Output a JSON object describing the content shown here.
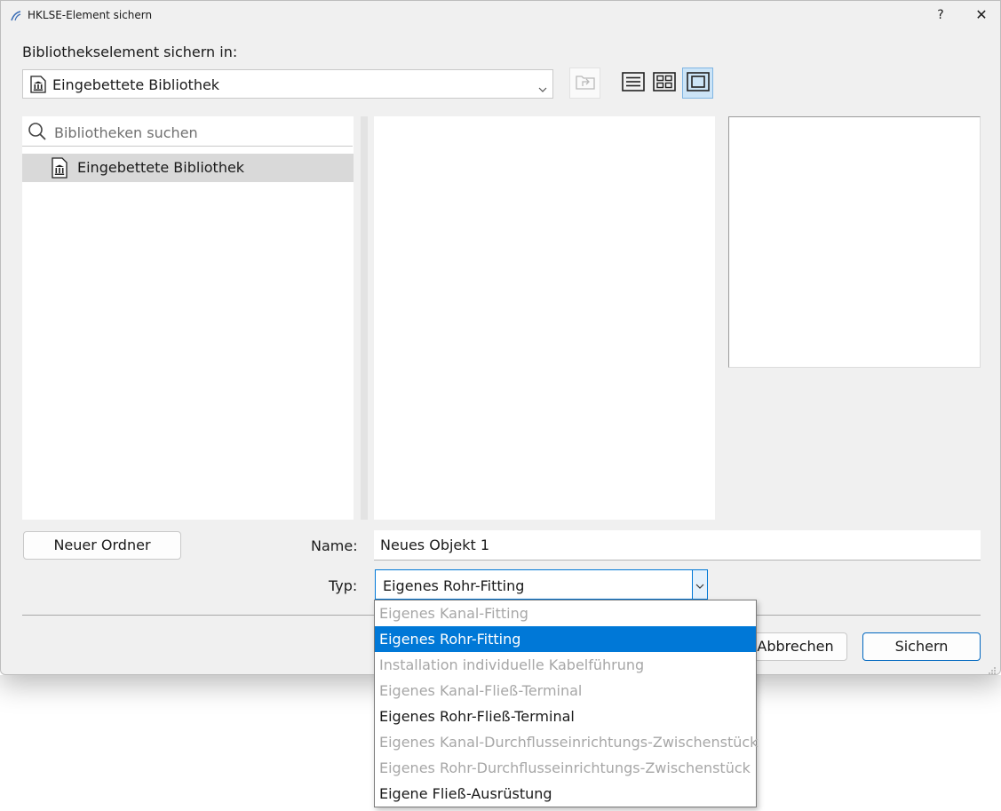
{
  "window": {
    "title": "HKLSE-Element sichern",
    "help_label": "?",
    "close_label": "✕"
  },
  "location": {
    "label": "Bibliothekselement sichern in:",
    "selected": "Eingebettete Bibliothek"
  },
  "search": {
    "placeholder": "Bibliotheken suchen"
  },
  "tree": {
    "items": [
      {
        "label": "Eingebettete Bibliothek",
        "selected": true
      }
    ]
  },
  "form": {
    "new_folder_label": "Neuer Ordner",
    "name_label": "Name:",
    "name_value": "Neues Objekt 1",
    "type_label": "Typ:",
    "type_value": "Eigenes Rohr-Fitting"
  },
  "type_options": [
    {
      "label": "Eigenes Kanal-Fitting",
      "state": "disabled"
    },
    {
      "label": "Eigenes Rohr-Fitting",
      "state": "selected"
    },
    {
      "label": "Installation individuelle Kabelführung",
      "state": "disabled"
    },
    {
      "label": "Eigenes Kanal-Fließ-Terminal",
      "state": "disabled"
    },
    {
      "label": "Eigenes Rohr-Fließ-Terminal",
      "state": "enabled"
    },
    {
      "label": "Eigenes Kanal-Durchflusseinrichtungs-Zwischenstück",
      "state": "disabled"
    },
    {
      "label": "Eigenes Rohr-Durchflusseinrichtungs-Zwischenstück",
      "state": "disabled"
    },
    {
      "label": "Eigene Fließ-Ausrüstung",
      "state": "enabled"
    }
  ],
  "buttons": {
    "cancel_label": "Abbrechen",
    "save_label": "Sichern"
  },
  "colors": {
    "accent": "#0078d7",
    "selection_bg": "#0078d7",
    "tree_selected_bg": "#d9d9d9",
    "dialog_bg": "#f0f0f0",
    "active_view_bg": "#cce4f7"
  },
  "icons": {
    "app": "archicad-logo-icon",
    "library": "library-building-icon",
    "search": "search-icon",
    "up_folder": "up-folder-icon",
    "list_view": "list-view-icon",
    "grid_view": "grid-view-icon",
    "preview_view": "preview-view-icon",
    "chevron": "chevron-down-icon"
  }
}
